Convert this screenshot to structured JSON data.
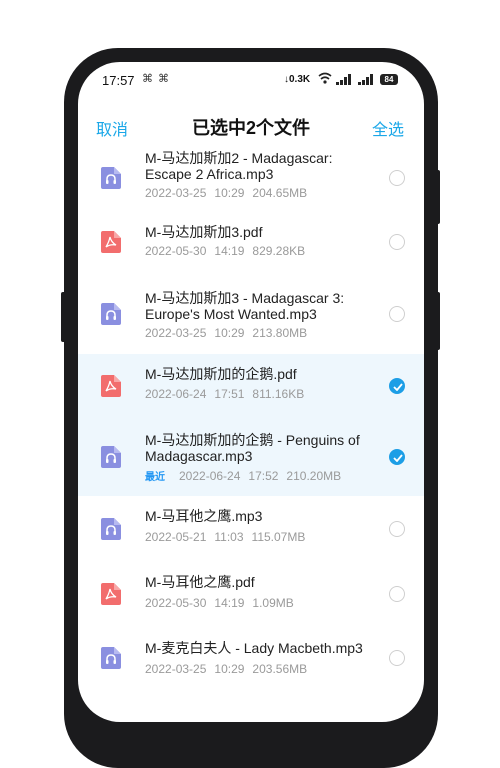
{
  "status": {
    "time": "17:57",
    "notifications": "⌘ ⌘",
    "speed": "↓0.3K",
    "battery": "84"
  },
  "header": {
    "cancel": "取消",
    "title": "已选中2个文件",
    "select_all": "全选"
  },
  "files": [
    {
      "name": "M-马达加斯加2 - Madagascar:\nEscape 2 Africa.mp3",
      "date": "2022-03-25",
      "time": "10:29",
      "size": "204.65MB",
      "type": "audio",
      "selected": false,
      "recent": ""
    },
    {
      "name": "M-马达加斯加3.pdf",
      "date": "2022-05-30",
      "time": "14:19",
      "size": "829.28KB",
      "type": "pdf",
      "selected": false,
      "recent": ""
    },
    {
      "name": "M-马达加斯加3 - Madagascar 3:\nEurope's Most Wanted.mp3",
      "date": "2022-03-25",
      "time": "10:29",
      "size": "213.80MB",
      "type": "audio",
      "selected": false,
      "recent": ""
    },
    {
      "name": "M-马达加斯加的企鹅.pdf",
      "date": "2022-06-24",
      "time": "17:51",
      "size": "811.16KB",
      "type": "pdf",
      "selected": true,
      "recent": ""
    },
    {
      "name": "M-马达加斯加的企鹅 - Penguins of\nMadagascar.mp3",
      "date": "2022-06-24",
      "time": "17:52",
      "size": "210.20MB",
      "type": "audio",
      "selected": true,
      "recent": "最近"
    },
    {
      "name": "M-马耳他之鹰.mp3",
      "date": "2022-05-21",
      "time": "11:03",
      "size": "115.07MB",
      "type": "audio",
      "selected": false,
      "recent": ""
    },
    {
      "name": "M-马耳他之鹰.pdf",
      "date": "2022-05-30",
      "time": "14:19",
      "size": "1.09MB",
      "type": "pdf",
      "selected": false,
      "recent": ""
    },
    {
      "name": "M-麦克白夫人 - Lady Macbeth.mp3",
      "date": "2022-03-25",
      "time": "10:29",
      "size": "203.56MB",
      "type": "audio",
      "selected": false,
      "recent": ""
    }
  ],
  "colors": {
    "accent": "#1aa7e8",
    "audio_icon": "#8a8fe0",
    "pdf_icon": "#f26d6d",
    "selected_row": "#eef7fd"
  }
}
